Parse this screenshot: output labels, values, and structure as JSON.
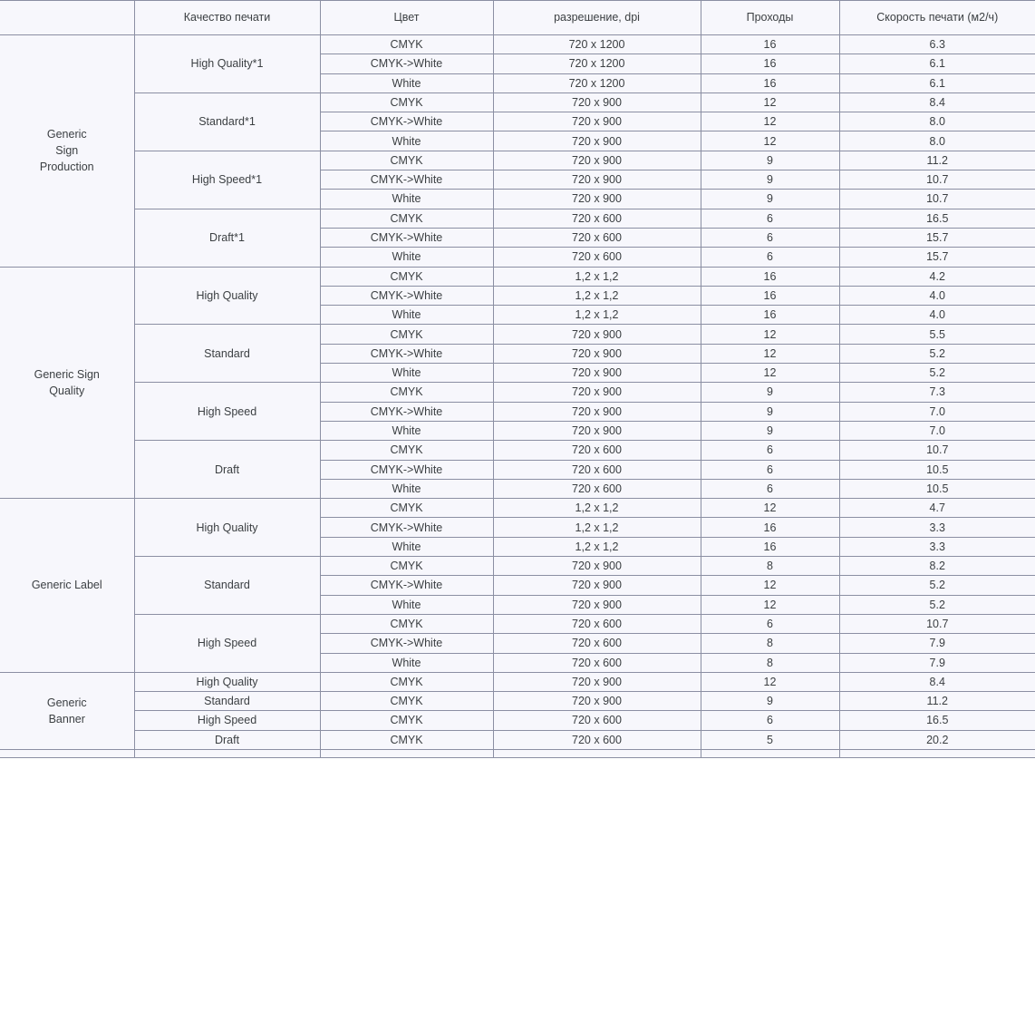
{
  "table": {
    "name": "print-mode-speed-table",
    "columns": [
      {
        "key": "family",
        "label": ""
      },
      {
        "key": "quality",
        "label": "Качество печати"
      },
      {
        "key": "color",
        "label": "Цвет"
      },
      {
        "key": "res",
        "label": "разрешение, dpi"
      },
      {
        "key": "pass",
        "label": "Проходы"
      },
      {
        "key": "speed",
        "label": "Скорость печати (м2/ч)"
      }
    ],
    "groups": [
      {
        "family": "Generic\nSign\nProduction",
        "family_lines": [
          "Generic",
          "Sign",
          "Production"
        ],
        "modes": [
          {
            "quality": "High Quality*1",
            "rows": [
              {
                "color": "CMYK",
                "res": "720 x 1200",
                "pass": "16",
                "speed": "6.3"
              },
              {
                "color": "CMYK->White",
                "res": "720 x 1200",
                "pass": "16",
                "speed": "6.1"
              },
              {
                "color": "White",
                "res": "720 x 1200",
                "pass": "16",
                "speed": "6.1"
              }
            ]
          },
          {
            "quality": "Standard*1",
            "rows": [
              {
                "color": "CMYK",
                "res": "720 x 900",
                "pass": "12",
                "speed": "8.4"
              },
              {
                "color": "CMYK->White",
                "res": "720 x 900",
                "pass": "12",
                "speed": "8.0"
              },
              {
                "color": "White",
                "res": "720 x 900",
                "pass": "12",
                "speed": "8.0"
              }
            ]
          },
          {
            "quality": "High Speed*1",
            "rows": [
              {
                "color": "CMYK",
                "res": "720 x 900",
                "pass": "9",
                "speed": "11.2"
              },
              {
                "color": "CMYK->White",
                "res": "720 x 900",
                "pass": "9",
                "speed": "10.7"
              },
              {
                "color": "White",
                "res": "720 x 900",
                "pass": "9",
                "speed": "10.7"
              }
            ]
          },
          {
            "quality": "Draft*1",
            "rows": [
              {
                "color": "CMYK",
                "res": "720 x 600",
                "pass": "6",
                "speed": "16.5"
              },
              {
                "color": "CMYK->White",
                "res": "720 x 600",
                "pass": "6",
                "speed": "15.7"
              },
              {
                "color": "White",
                "res": "720 x 600",
                "pass": "6",
                "speed": "15.7"
              }
            ]
          }
        ]
      },
      {
        "family": "Generic Sign\nQuality",
        "family_lines": [
          "Generic Sign",
          "Quality"
        ],
        "modes": [
          {
            "quality": "High Quality",
            "rows": [
              {
                "color": "CMYK",
                "res": "1,2 x 1,2",
                "pass": "16",
                "speed": "4.2"
              },
              {
                "color": "CMYK->White",
                "res": "1,2 x 1,2",
                "pass": "16",
                "speed": "4.0"
              },
              {
                "color": "White",
                "res": "1,2 x 1,2",
                "pass": "16",
                "speed": "4.0"
              }
            ]
          },
          {
            "quality": "Standard",
            "rows": [
              {
                "color": "CMYK",
                "res": "720 x 900",
                "pass": "12",
                "speed": "5.5"
              },
              {
                "color": "CMYK->White",
                "res": "720 x 900",
                "pass": "12",
                "speed": "5.2"
              },
              {
                "color": "White",
                "res": "720 x 900",
                "pass": "12",
                "speed": "5.2"
              }
            ]
          },
          {
            "quality": "High Speed",
            "rows": [
              {
                "color": "CMYK",
                "res": "720 x 900",
                "pass": "9",
                "speed": "7.3"
              },
              {
                "color": "CMYK->White",
                "res": "720 x 900",
                "pass": "9",
                "speed": "7.0"
              },
              {
                "color": "White",
                "res": "720 x 900",
                "pass": "9",
                "speed": "7.0"
              }
            ]
          },
          {
            "quality": "Draft",
            "rows": [
              {
                "color": "CMYK",
                "res": "720 x 600",
                "pass": "6",
                "speed": "10.7"
              },
              {
                "color": "CMYK->White",
                "res": "720 x 600",
                "pass": "6",
                "speed": "10.5"
              },
              {
                "color": "White",
                "res": "720 x 600",
                "pass": "6",
                "speed": "10.5"
              }
            ]
          }
        ]
      },
      {
        "family": "Generic Label",
        "family_lines": [
          "Generic Label"
        ],
        "modes": [
          {
            "quality": "High Quality",
            "rows": [
              {
                "color": "CMYK",
                "res": "1,2 x 1,2",
                "pass": "12",
                "speed": "4.7"
              },
              {
                "color": "CMYK->White",
                "res": "1,2 x 1,2",
                "pass": "16",
                "speed": "3.3"
              },
              {
                "color": "White",
                "res": "1,2 x 1,2",
                "pass": "16",
                "speed": "3.3"
              }
            ]
          },
          {
            "quality": "Standard",
            "rows": [
              {
                "color": "CMYK",
                "res": "720 x 900",
                "pass": "8",
                "speed": "8.2"
              },
              {
                "color": "CMYK->White",
                "res": "720 x 900",
                "pass": "12",
                "speed": "5.2"
              },
              {
                "color": "White",
                "res": "720 x 900",
                "pass": "12",
                "speed": "5.2"
              }
            ]
          },
          {
            "quality": "High Speed",
            "rows": [
              {
                "color": "CMYK",
                "res": "720 x 600",
                "pass": "6",
                "speed": "10.7"
              },
              {
                "color": "CMYK->White",
                "res": "720 x 600",
                "pass": "8",
                "speed": "7.9"
              },
              {
                "color": "White",
                "res": "720 x 600",
                "pass": "8",
                "speed": "7.9"
              }
            ]
          }
        ]
      },
      {
        "family": "Generic\nBanner",
        "family_lines": [
          "Generic",
          "Banner"
        ],
        "modes": [
          {
            "quality": "High Quality",
            "rows": [
              {
                "color": "CMYK",
                "res": "720 x 900",
                "pass": "12",
                "speed": "8.4"
              }
            ]
          },
          {
            "quality": "Standard",
            "rows": [
              {
                "color": "CMYK",
                "res": "720 x 900",
                "pass": "9",
                "speed": "11.2"
              }
            ]
          },
          {
            "quality": "High Speed",
            "rows": [
              {
                "color": "CMYK",
                "res": "720 x 600",
                "pass": "6",
                "speed": "16.5"
              }
            ]
          },
          {
            "quality": "Draft",
            "rows": [
              {
                "color": "CMYK",
                "res": "720 x 600",
                "pass": "5",
                "speed": "20.2"
              }
            ]
          }
        ]
      }
    ]
  },
  "colors": {
    "surface": "#f7f7fc",
    "grid_line": "#8b8fa3",
    "text": "#3c4043",
    "page_background": "#ffffff"
  }
}
